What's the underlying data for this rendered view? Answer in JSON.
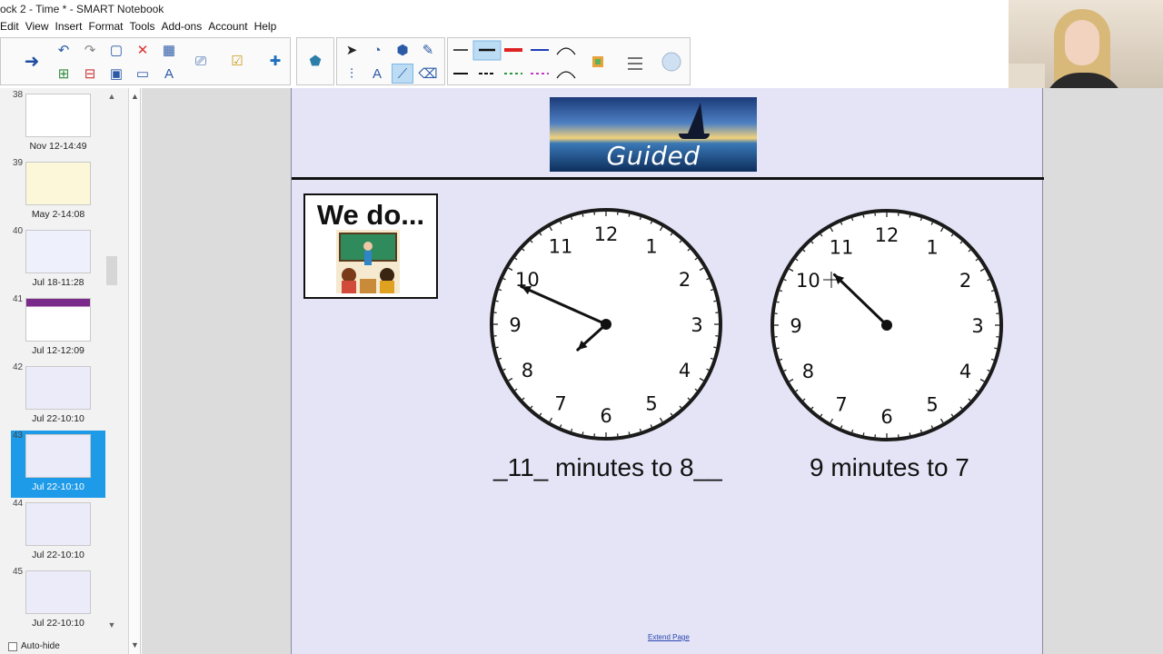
{
  "window": {
    "title": "ock 2 - Time  * - SMART Notebook"
  },
  "menu": [
    "Edit",
    "View",
    "Insert",
    "Format",
    "Tools",
    "Add-ons",
    "Account",
    "Help"
  ],
  "toolbar": {
    "icons": [
      "back-arrow-icon",
      "forward-arrow-icon",
      "undo-icon",
      "redo-icon",
      "new-page-icon",
      "delete-icon",
      "table-icon",
      "screen-shade-icon",
      "check-icon",
      "addons-icon",
      "select-icon",
      "shapes-icon",
      "fill-icon",
      "pen-icon",
      "text-icon",
      "line-icon",
      "eraser-icon",
      "color-palette-icon",
      "properties-icon",
      "cloud-icon"
    ]
  },
  "sidebar": {
    "pages": [
      {
        "number": "38",
        "label": "Nov 12-14:49",
        "selected": false
      },
      {
        "number": "39",
        "label": "May 2-14:08",
        "selected": false
      },
      {
        "number": "40",
        "label": "Jul 18-11:28",
        "selected": false
      },
      {
        "number": "41",
        "label": "Jul 12-12:09",
        "selected": false
      },
      {
        "number": "42",
        "label": "Jul 22-10:10",
        "selected": false
      },
      {
        "number": "43",
        "label": "Jul 22-10:10",
        "selected": true
      },
      {
        "number": "44",
        "label": "Jul 22-10:10",
        "selected": false
      },
      {
        "number": "45",
        "label": "Jul 22-10:10",
        "selected": false
      }
    ],
    "autohide_label": "Auto-hide"
  },
  "page": {
    "banner_text": "Guided Practice",
    "wedo_text": "We do...",
    "clock_numbers": [
      "12",
      "1",
      "2",
      "3",
      "4",
      "5",
      "6",
      "7",
      "8",
      "9",
      "10",
      "11"
    ],
    "captions": [
      "_11_ minutes to 8__",
      "9 minutes to 7"
    ],
    "extend_label": "Extend Page"
  },
  "colors": {
    "page_bg": "#e4e4f6",
    "selected_thumb": "#1e9be8",
    "workarea": "#dcdcdc"
  }
}
